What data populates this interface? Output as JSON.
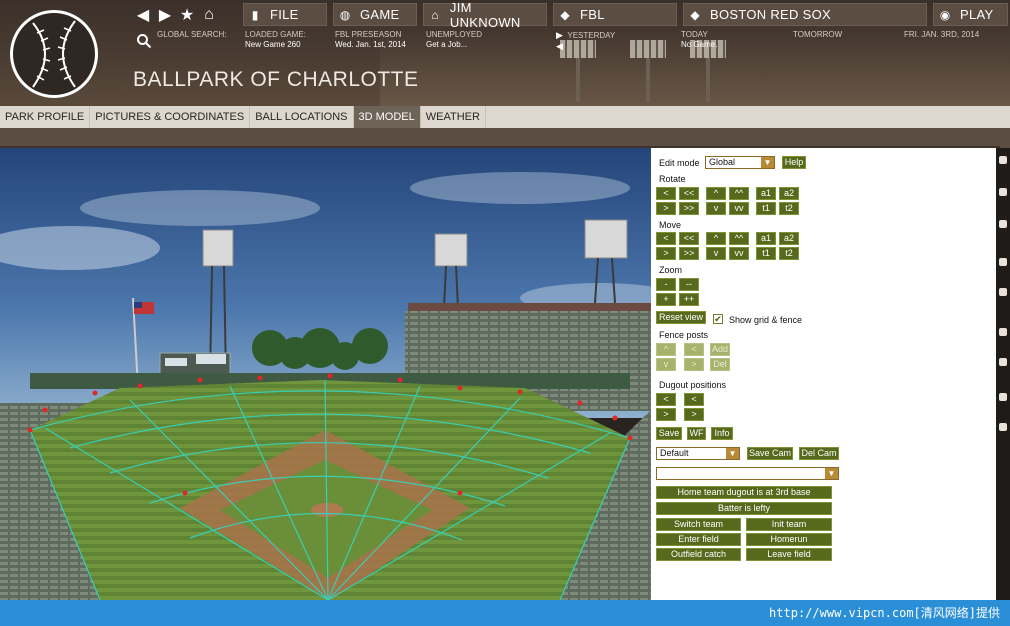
{
  "header": {
    "nav_arrows": [
      "◀",
      "▶",
      "★",
      "⌂"
    ],
    "buttons": [
      {
        "label": "FILE",
        "icon": "file-icon"
      },
      {
        "label": "GAME",
        "icon": "globe-icon"
      },
      {
        "label": "JIM UNKNOWN",
        "icon": "home-icon"
      },
      {
        "label": "FBL",
        "icon": "league-diamond-icon"
      },
      {
        "label": "BOSTON RED SOX",
        "icon": "team-diamond-icon"
      },
      {
        "label": "PLAY",
        "icon": "chevron-circle-icon"
      }
    ],
    "info": {
      "global_search": "GLOBAL SEARCH:",
      "loaded_game_label": "LOADED GAME:",
      "loaded_game_value": "New Game 260",
      "preseason_label": "FBL PRESEASON",
      "preseason_value": "Wed. Jan. 1st, 2014",
      "unemployed_label": "UNEMPLOYED",
      "unemployed_value": "Get a Job...",
      "yesterday_label": "YESTERDAY",
      "today_label": "TODAY",
      "today_value": "No Game.",
      "tomorrow_label": "TOMORROW",
      "future_date": "FRI. JAN. 3RD, 2014"
    },
    "park_title": "BALLPARK OF CHARLOTTE"
  },
  "tabs": [
    {
      "label": "PARK PROFILE",
      "active": false
    },
    {
      "label": "PICTURES & COORDINATES",
      "active": false
    },
    {
      "label": "BALL LOCATIONS",
      "active": false
    },
    {
      "label": "3D MODEL",
      "active": true
    },
    {
      "label": "WEATHER",
      "active": false
    }
  ],
  "panel": {
    "edit_mode_label": "Edit mode",
    "edit_mode_value": "Global",
    "help": "Help",
    "rotate_label": "Rotate",
    "move_label": "Move",
    "zoom_label": "Zoom",
    "step_buttons": {
      "less": "<",
      "less2": "<<",
      "more": ">",
      "more2": ">>",
      "up": "^",
      "up2": "^^",
      "down": "v",
      "down2": "vv",
      "a1": "a1",
      "a2": "a2",
      "t1": "t1",
      "t2": "t2"
    },
    "zoom_buttons": {
      "minus": "-",
      "minus2": "--",
      "plus": "+",
      "plus2": "++"
    },
    "reset_view": "Reset view",
    "show_grid_fence": "Show grid & fence",
    "show_grid_checked": true,
    "fence_posts_label": "Fence posts",
    "fence_buttons": {
      "up": "^",
      "left": "<",
      "add": "Add",
      "down": "v",
      "right": ">",
      "del": "Del"
    },
    "dugout_label": "Dugout positions",
    "dugout_buttons": {
      "l1": "<",
      "l2": "<",
      "r1": ">",
      "r2": ">"
    },
    "save": "Save",
    "wf": "WF",
    "info": "Info",
    "cam_select": "Default",
    "save_cam": "Save Cam",
    "del_cam": "Del Cam",
    "empty_select": "",
    "home_dugout": "Home team dugout is at 3rd base",
    "batter_lefty": "Batter is lefty",
    "switch_team": "Switch team",
    "init_team": "Init team",
    "enter_field": "Enter field",
    "homerun": "Homerun",
    "outfield_catch": "Outfield catch",
    "leave_field": "Leave field"
  },
  "footer": {
    "watermark": "http://www.vipcn.com[清风网络]提供"
  },
  "colors": {
    "accent_green": "#57691c",
    "header_brown": "#4a3c32",
    "tab_active": "#6d6357",
    "footer_blue": "#2a8fd6"
  }
}
